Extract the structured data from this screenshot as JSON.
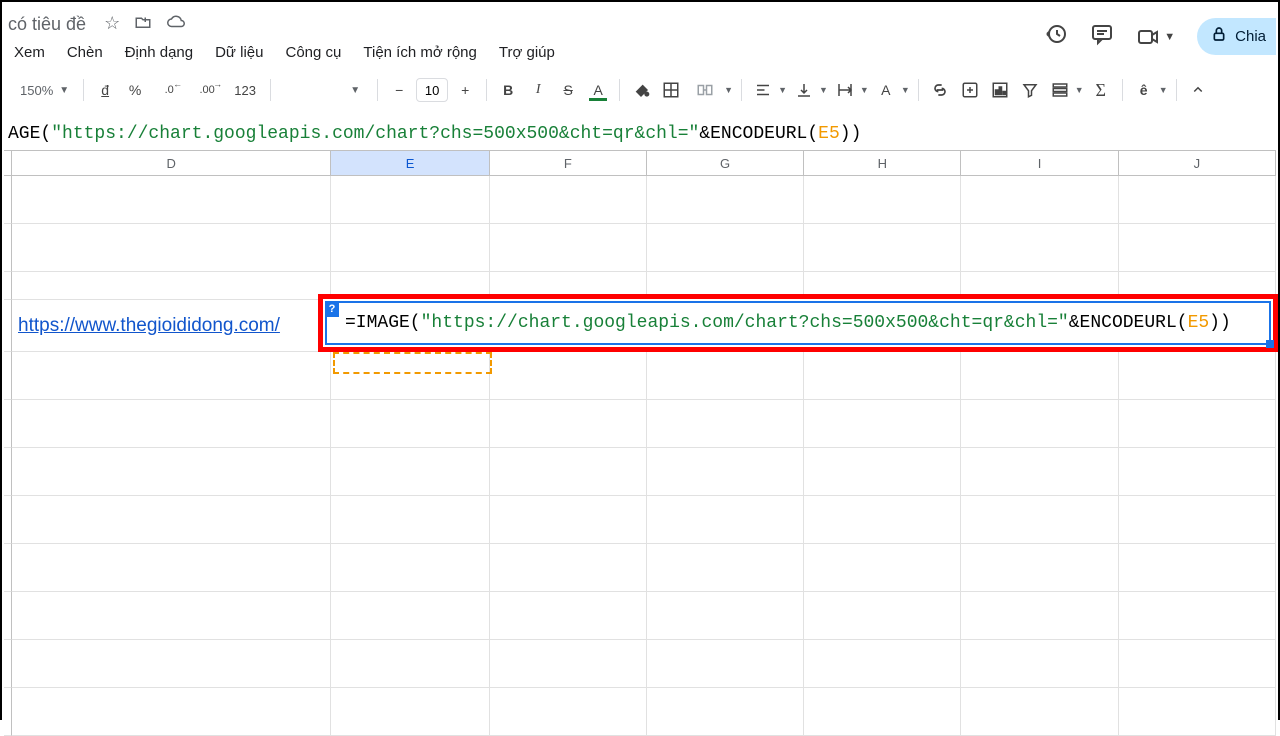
{
  "titlebar": {
    "doc_title": "có tiêu đề",
    "share_label": "Chia"
  },
  "menu": {
    "view": "Xem",
    "insert": "Chèn",
    "format": "Định dạng",
    "data": "Dữ liệu",
    "tools": "Công cụ",
    "extensions": "Tiện ích mở rộng",
    "help": "Trợ giúp"
  },
  "toolbar": {
    "zoom": "150%",
    "currency_symbol": "đ",
    "percent_symbol": "%",
    "decimal_dec": ".0",
    "decimal_inc": ".00",
    "number_format": "123",
    "font_size": "10"
  },
  "formula_bar": {
    "prefix": "AGE(",
    "url": "\"https://chart.googleapis.com/chart?chs=500x500&cht=qr&chl=\"",
    "mid": "&ENCODEURL(",
    "ref": "E5",
    "suffix": "))"
  },
  "columns": [
    {
      "label": "D",
      "cls": "col-D"
    },
    {
      "label": "E",
      "cls": "col-E selected"
    },
    {
      "label": "F",
      "cls": "col-F"
    },
    {
      "label": "G",
      "cls": "col-G"
    },
    {
      "label": "H",
      "cls": "col-H"
    },
    {
      "label": "I",
      "cls": "col-I"
    },
    {
      "label": "J",
      "cls": "col-J"
    }
  ],
  "cells": {
    "d5_link": "https://www.thegioididong.com/"
  },
  "active_formula": {
    "prefix": "=IMAGE(",
    "url": "\"https://chart.googleapis.com/chart?chs=500x500&cht=qr&chl=\"",
    "mid": "&ENCODEURL(",
    "ref": "E5",
    "suffix": "))"
  }
}
